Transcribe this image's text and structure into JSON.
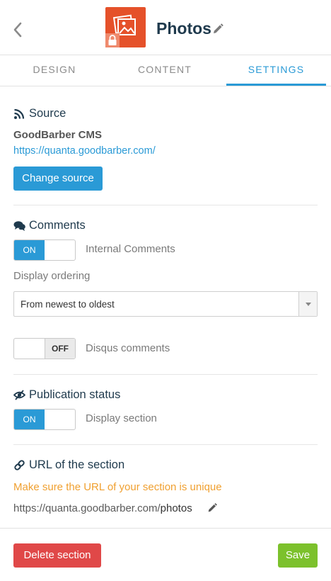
{
  "header": {
    "title": "Photos",
    "back_icon": "chevron-left-icon",
    "app_icon": "photos-icon",
    "lock_icon": "lock-icon",
    "edit_icon": "pencil-icon"
  },
  "tabs": [
    {
      "label": "DESIGN",
      "active": false
    },
    {
      "label": "CONTENT",
      "active": false
    },
    {
      "label": "SETTINGS",
      "active": true
    }
  ],
  "source": {
    "title": "Source",
    "icon": "rss-icon",
    "name": "GoodBarber CMS",
    "url": "https://quanta.goodbarber.com/",
    "change_button": "Change source"
  },
  "comments": {
    "title": "Comments",
    "icon": "comments-icon",
    "internal_toggle": {
      "state": "ON",
      "label": "Internal Comments"
    },
    "ordering_label": "Display ordering",
    "ordering_value": "From newest to oldest",
    "disqus_toggle": {
      "state": "OFF",
      "label": "Disqus comments"
    }
  },
  "publication": {
    "title": "Publication status",
    "icon": "eye-slash-icon",
    "toggle": {
      "state": "ON",
      "label": "Display section"
    }
  },
  "url_section": {
    "title": "URL of the section",
    "icon": "link-icon",
    "warning": "Make sure the URL of your section is unique",
    "base": "https://quanta.goodbarber.com/",
    "slug": "photos"
  },
  "footer": {
    "delete_button": "Delete section",
    "save_button": "Save"
  },
  "colors": {
    "accent": "#2a9ad6",
    "title": "#1f3a4d",
    "app_icon": "#e5512a",
    "warning": "#f0a030",
    "danger": "#e04848",
    "success": "#7cc12c"
  }
}
